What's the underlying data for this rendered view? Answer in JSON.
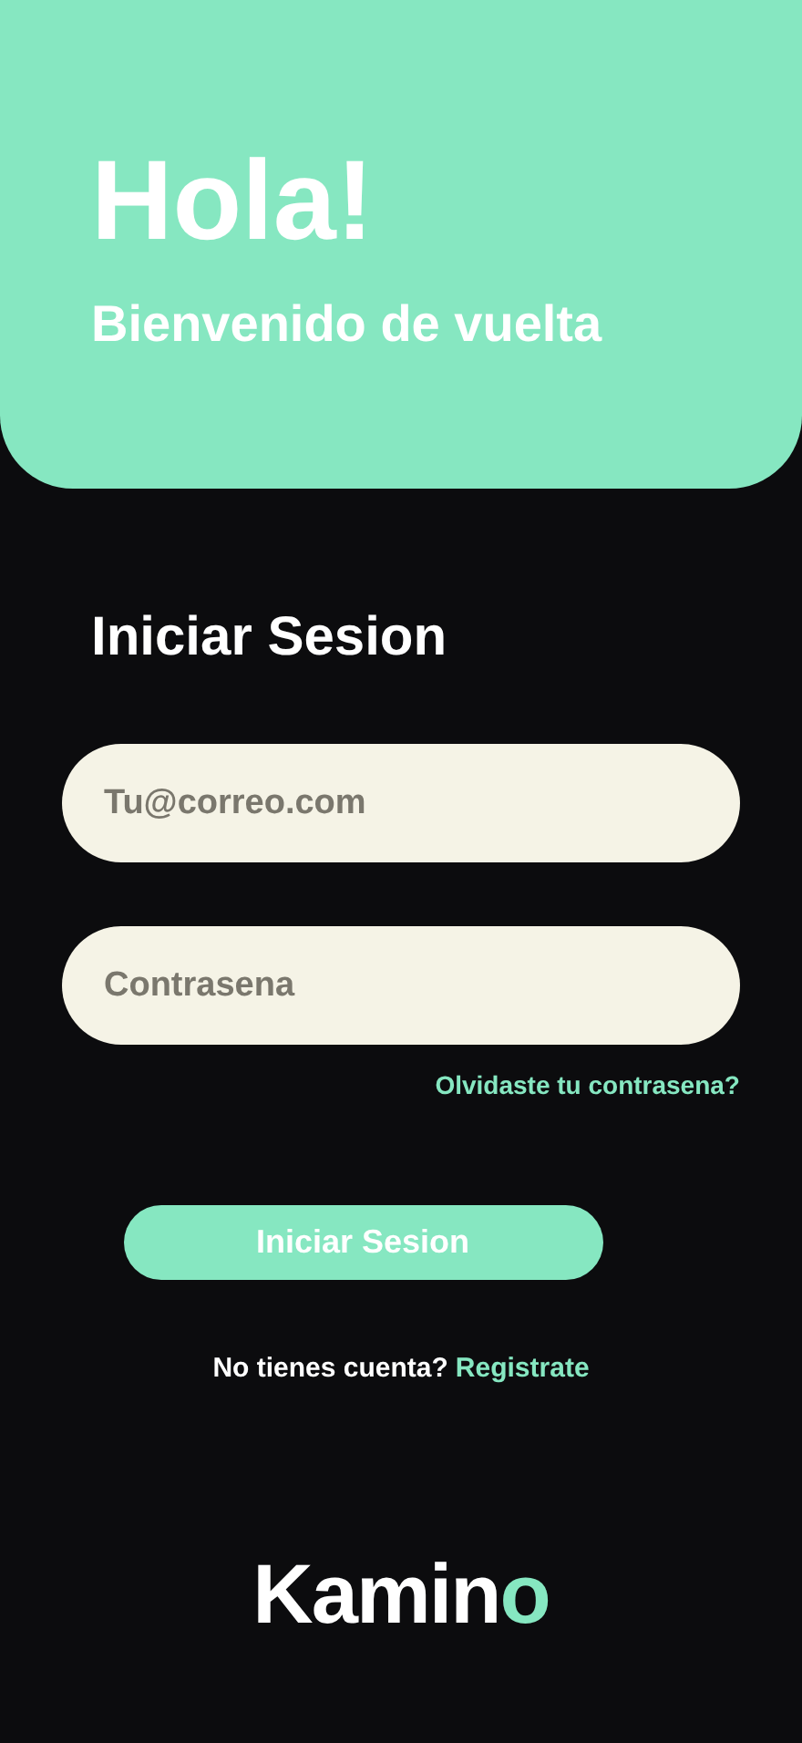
{
  "header": {
    "title": "Hola!",
    "subtitle": "Bienvenido de vuelta"
  },
  "form": {
    "heading": "Iniciar Sesion",
    "fields": [
      {
        "placeholder": "Tu@correo.com"
      },
      {
        "placeholder": "Contrasena"
      }
    ],
    "forgot_link": "Olvidaste tu contrasena?",
    "submit": "Iniciar Sesion"
  },
  "signup": {
    "prompt": "No tienes cuenta?",
    "link": "Registrate"
  },
  "logo": {
    "text": "Kamin",
    "accent": "o"
  }
}
